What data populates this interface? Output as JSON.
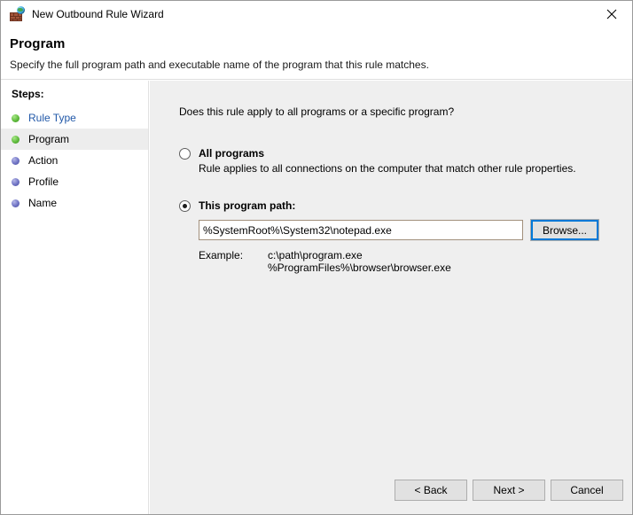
{
  "window": {
    "title": "New Outbound Rule Wizard",
    "icon": "firewall-globe-icon",
    "close_label": "✕"
  },
  "header": {
    "title": "Program",
    "subtitle": "Specify the full program path and executable name of the program that this rule matches."
  },
  "sidebar": {
    "heading": "Steps:",
    "items": [
      {
        "label": "Rule Type",
        "state": "done",
        "style": "link"
      },
      {
        "label": "Program",
        "state": "done",
        "style": "current"
      },
      {
        "label": "Action",
        "state": "pending",
        "style": "normal"
      },
      {
        "label": "Profile",
        "state": "pending",
        "style": "normal"
      },
      {
        "label": "Name",
        "state": "pending",
        "style": "normal"
      }
    ]
  },
  "main": {
    "question": "Does this rule apply to all programs or a specific program?",
    "option_all": {
      "label": "All programs",
      "description": "Rule applies to all connections on the computer that match other rule properties.",
      "selected": false
    },
    "option_path": {
      "label": "This program path:",
      "selected": true,
      "input_value": "%SystemRoot%\\System32\\notepad.exe",
      "input_placeholder": "",
      "browse_label": "Browse..."
    },
    "example": {
      "label": "Example:",
      "lines": [
        "c:\\path\\program.exe",
        "%ProgramFiles%\\browser\\browser.exe"
      ]
    }
  },
  "footer": {
    "back_label": "< Back",
    "next_label": "Next >",
    "cancel_label": "Cancel"
  },
  "colors": {
    "link": "#2158a8",
    "focus": "#0078d7",
    "content_bg": "#efefef",
    "step_done": "#5fbb3c",
    "step_pending": "#6f73c4"
  }
}
